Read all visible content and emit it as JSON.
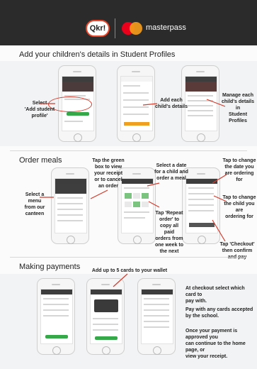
{
  "header": {
    "logo_qkr": "Qkr!",
    "brand": "masterpass"
  },
  "sections": [
    {
      "title": "Add your children's details in Student Profiles",
      "labels": [
        "Select\n'Add student profile'",
        "Add each\nchild's details",
        "Manage each\nchild's details in\nStudent Profiles"
      ]
    },
    {
      "title": "Order meals",
      "labels": [
        "Tap the green\nbox to view\nyour receipt\nor to cancel\nan order",
        "Select a date\nfor a child and\norder a meal",
        "Tap to change\nthe date you\nare ordering for",
        "Select a menu\nfrom our canteen",
        "Tap to change\nthe child you are\nordering for",
        "Tap 'Repeat\norder' to\ncopy all paid\norders from\none week to\nthe next",
        "Tap 'Checkout'\nthen confirm and pay"
      ]
    },
    {
      "title": "Making payments",
      "labels": [
        "Add up to 5 cards to your wallet"
      ],
      "notes": [
        "At checkout select which card to\npay with.",
        "Pay with any cards accepted\nby the school.",
        "Once your payment is approved you\ncan continue to the home page, or\nview your receipt."
      ]
    }
  ],
  "colors": {
    "header_bg": "#2b2b2b",
    "annotation_red": "#d33b2c",
    "button_green": "#36a84a",
    "button_orange": "#f0a020",
    "mastercard_red": "#eb001b",
    "mastercard_yellow": "#f79e1b"
  }
}
